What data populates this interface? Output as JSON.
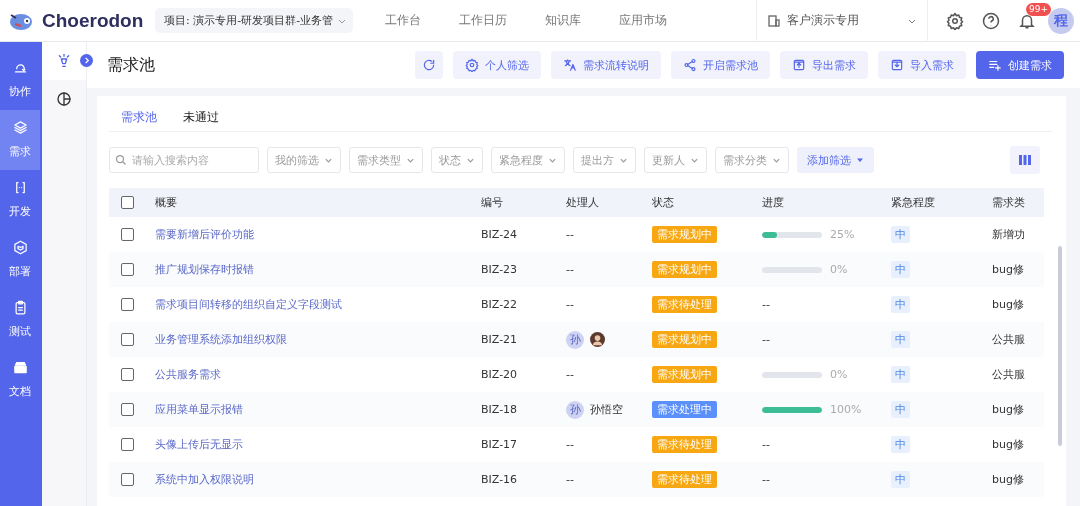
{
  "app": {
    "name": "Choerodon"
  },
  "project_selector": {
    "value": "项目: 演示专用-研发项目群-业务管"
  },
  "top_nav": [
    {
      "label": "工作台",
      "selected": false
    },
    {
      "label": "工作日历",
      "selected": false
    },
    {
      "label": "知识库",
      "selected": false
    },
    {
      "label": "应用市场",
      "selected": false
    }
  ],
  "org_selector": {
    "value": "客户演示专用"
  },
  "notifications": {
    "badge": "99+"
  },
  "avatar": {
    "initial": "程"
  },
  "side_nav": [
    {
      "label": "协作",
      "selected": false
    },
    {
      "label": "需求",
      "selected": true
    },
    {
      "label": "开发",
      "selected": false
    },
    {
      "label": "部署",
      "selected": false
    },
    {
      "label": "测试",
      "selected": false
    },
    {
      "label": "文档",
      "selected": false
    }
  ],
  "sub_nav": [
    {
      "selected": true
    },
    {
      "selected": false
    }
  ],
  "page": {
    "title": "需求池"
  },
  "toolbar": [
    {
      "kind": "icon"
    },
    {
      "label": "个人筛选",
      "kind": "secondary"
    },
    {
      "label": "需求流转说明",
      "kind": "secondary"
    },
    {
      "label": "开启需求池",
      "kind": "secondary"
    },
    {
      "label": "导出需求",
      "kind": "secondary"
    },
    {
      "label": "导入需求",
      "kind": "secondary"
    },
    {
      "label": "创建需求",
      "kind": "primary"
    }
  ],
  "tabs": [
    {
      "label": "需求池",
      "selected": true
    },
    {
      "label": "未通过",
      "selected": false
    }
  ],
  "search": {
    "placeholder": "请输入搜索内容"
  },
  "filters": [
    "我的筛选",
    "需求类型",
    "状态",
    "紧急程度",
    "提出方",
    "更新人",
    "需求分类"
  ],
  "add_filter": {
    "label": "添加筛选"
  },
  "table": {
    "select_all_checked": false,
    "columns": [
      "概要",
      "编号",
      "处理人",
      "状态",
      "进度",
      "紧急程度",
      "需求类"
    ],
    "rows": [
      {
        "checked": false,
        "summary": "需要新增后评价功能",
        "id": "BIZ-24",
        "assignee": "--",
        "status": "需求规划中",
        "color": "#f7a711",
        "progress": {
          "level": 0.25,
          "reading": "25%"
        },
        "urgency": "中",
        "type": "新增功"
      },
      {
        "checked": false,
        "summary": "推广规划保存时报错",
        "id": "BIZ-23",
        "assignee": "--",
        "status": "需求规划中",
        "color": "#f7a711",
        "progress": {
          "level": 0,
          "reading": "0%"
        },
        "urgency": "中",
        "type": "bug修"
      },
      {
        "checked": false,
        "summary": "需求项目间转移的组织自定义字段测试",
        "id": "BIZ-22",
        "assignee": "--",
        "status": "需求待处理",
        "color": "#f7a711",
        "progress_text": "--",
        "urgency": "中",
        "type": "bug修"
      },
      {
        "checked": false,
        "summary": "业务管理系统添加组织权限",
        "id": "BIZ-21",
        "assignees": [
          {
            "kind": "initial",
            "text": "孙"
          },
          {
            "kind": "photo"
          }
        ],
        "status": "需求规划中",
        "color": "#f7a711",
        "progress_text": "--",
        "urgency": "中",
        "type": "公共服"
      },
      {
        "checked": false,
        "summary": "公共服务需求",
        "id": "BIZ-20",
        "assignee": "--",
        "status": "需求规划中",
        "color": "#f7a711",
        "progress": {
          "level": 0,
          "reading": "0%"
        },
        "urgency": "中",
        "type": "公共服"
      },
      {
        "checked": false,
        "summary": "应用菜单显示报错",
        "id": "BIZ-18",
        "assignees": [
          {
            "kind": "initial",
            "text": "孙"
          }
        ],
        "assignee_name": "孙悟空",
        "status": "需求处理中",
        "color": "#5b8ff9",
        "progress": {
          "level": 1,
          "reading": "100%"
        },
        "urgency": "中",
        "type": "bug修"
      },
      {
        "checked": false,
        "summary": "头像上传后无显示",
        "id": "BIZ-17",
        "assignee": "--",
        "status": "需求待处理",
        "color": "#f7a711",
        "progress_text": "--",
        "urgency": "中",
        "type": "bug修"
      },
      {
        "checked": false,
        "summary": "系统中加入权限说明",
        "id": "BIZ-16",
        "assignee": "--",
        "status": "需求待处理",
        "color": "#f7a711",
        "progress_text": "--",
        "urgency": "中",
        "type": "bug修"
      }
    ]
  }
}
